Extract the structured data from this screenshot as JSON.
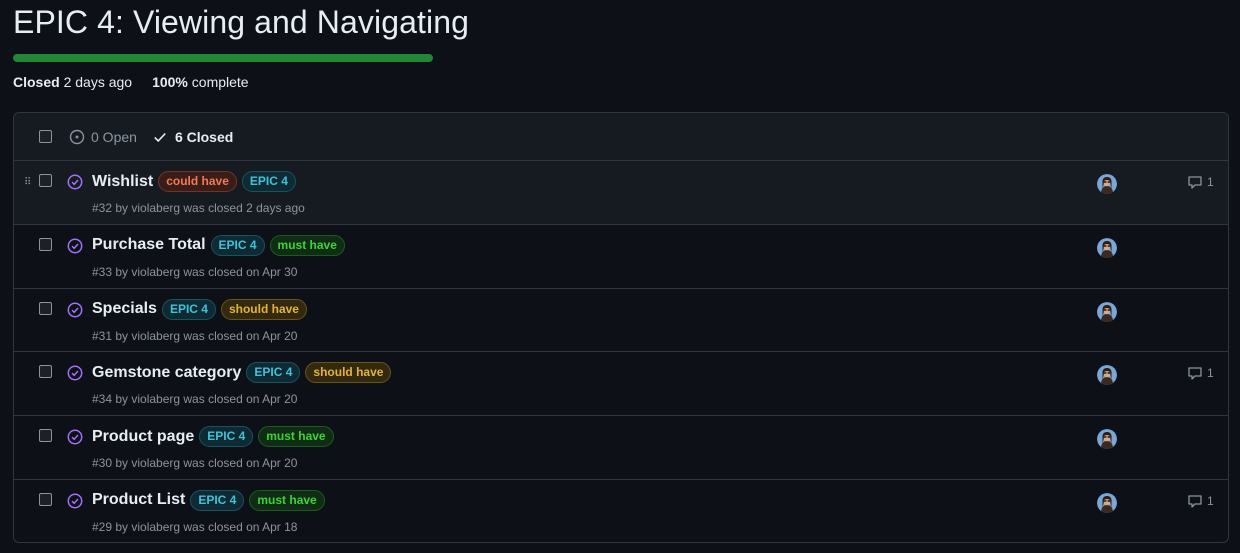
{
  "milestone": {
    "title": "EPIC 4: Viewing and Navigating",
    "progress": 1.0,
    "status_label": "Closed",
    "status_time": "2 days ago",
    "percent": "100%",
    "percent_suffix": "complete"
  },
  "filters": {
    "open_label": "0 Open",
    "closed_label": "6 Closed"
  },
  "colors": {
    "progress": "#238636",
    "closed_icon": "#a371f7"
  },
  "issues": [
    {
      "title": "Wishlist",
      "labels": [
        {
          "text": "could have",
          "kind": "could"
        },
        {
          "text": "EPIC 4",
          "kind": "epic"
        }
      ],
      "meta": "#32 by violaberg was closed 2 days ago",
      "comments": "1"
    },
    {
      "title": "Purchase Total",
      "labels": [
        {
          "text": "EPIC 4",
          "kind": "epic"
        },
        {
          "text": "must have",
          "kind": "must"
        }
      ],
      "meta": "#33 by violaberg was closed on Apr 30",
      "comments": ""
    },
    {
      "title": "Specials",
      "labels": [
        {
          "text": "EPIC 4",
          "kind": "epic"
        },
        {
          "text": "should have",
          "kind": "should"
        }
      ],
      "meta": "#31 by violaberg was closed on Apr 20",
      "comments": ""
    },
    {
      "title": "Gemstone category",
      "labels": [
        {
          "text": "EPIC 4",
          "kind": "epic"
        },
        {
          "text": "should have",
          "kind": "should"
        }
      ],
      "meta": "#34 by violaberg was closed on Apr 20",
      "comments": "1"
    },
    {
      "title": "Product page",
      "labels": [
        {
          "text": "EPIC 4",
          "kind": "epic"
        },
        {
          "text": "must have",
          "kind": "must"
        }
      ],
      "meta": "#30 by violaberg was closed on Apr 20",
      "comments": ""
    },
    {
      "title": "Product List",
      "labels": [
        {
          "text": "EPIC 4",
          "kind": "epic"
        },
        {
          "text": "must have",
          "kind": "must"
        }
      ],
      "meta": "#29 by violaberg was closed on Apr 18",
      "comments": "1"
    }
  ]
}
